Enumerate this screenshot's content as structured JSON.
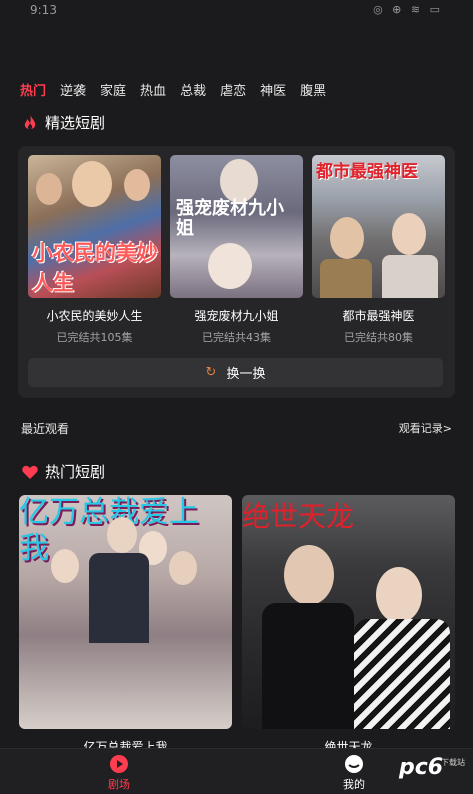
{
  "status": {
    "time": "9:13",
    "icons": "◎ ⊕ ≋ ▭"
  },
  "tabs": [
    {
      "label": "热门",
      "active": true
    },
    {
      "label": "逆袭"
    },
    {
      "label": "家庭"
    },
    {
      "label": "热血"
    },
    {
      "label": "总裁"
    },
    {
      "label": "虐恋"
    },
    {
      "label": "神医"
    },
    {
      "label": "腹黑"
    }
  ],
  "featured": {
    "title": "精选短剧",
    "items": [
      {
        "title": "小农民的美妙人生",
        "sub": "已完结共105集",
        "poster_text": "小农民的美妙人生"
      },
      {
        "title": "强宠废材九小姐",
        "sub": "已完结共43集",
        "poster_text": "强宠废材九小姐"
      },
      {
        "title": "都市最强神医",
        "sub": "已完结共80集",
        "poster_text": "都市最强神医"
      }
    ],
    "swap_label": "换一换"
  },
  "recent": {
    "label": "最近观看",
    "history": "观看记录>"
  },
  "hot": {
    "title": "热门短剧",
    "items": [
      {
        "title": "亿万总裁爱上我",
        "poster_text": "亿万总裁爱上我"
      },
      {
        "title": "绝世天龙",
        "poster_text": "绝世天龙"
      }
    ]
  },
  "bottom_nav": [
    {
      "label": "剧场",
      "active": true
    },
    {
      "label": "我的"
    }
  ],
  "watermark": {
    "logo": "pc6",
    "sub": "下载站"
  },
  "colors": {
    "accent": "#ff3d50",
    "bg": "#1b1b1d",
    "card": "#262629"
  }
}
